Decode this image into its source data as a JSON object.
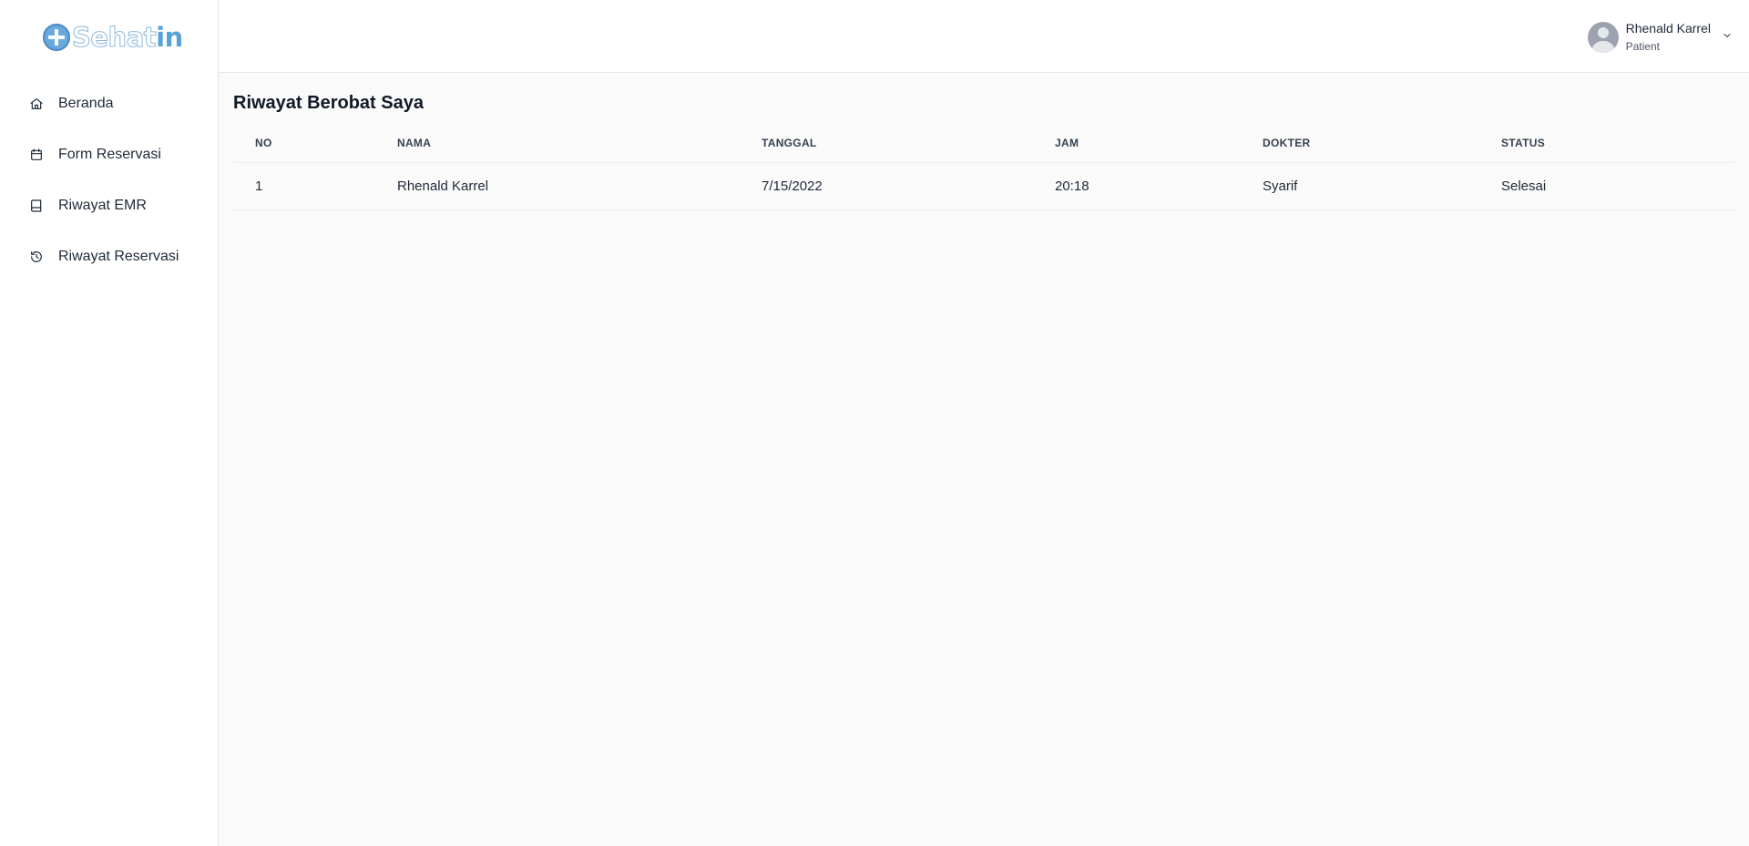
{
  "brand": {
    "part1": "Sehat",
    "part2": "in"
  },
  "sidebar": {
    "items": [
      {
        "label": "Beranda",
        "icon": "home-icon"
      },
      {
        "label": "Form Reservasi",
        "icon": "calendar-icon"
      },
      {
        "label": "Riwayat EMR",
        "icon": "book-icon"
      },
      {
        "label": "Riwayat Reservasi",
        "icon": "history-icon"
      }
    ]
  },
  "header": {
    "user_name": "Rhenald Karrel",
    "user_role": "Patient"
  },
  "main": {
    "title": "Riwayat Berobat Saya",
    "columns": [
      "NO",
      "NAMA",
      "TANGGAL",
      "JAM",
      "DOKTER",
      "STATUS"
    ],
    "rows": [
      [
        "1",
        "Rhenald Karrel",
        "7/15/2022",
        "20:18",
        "Syarif",
        "Selesai"
      ]
    ]
  },
  "colors": {
    "brand_blue": "#5aa1d8",
    "sidebar_bg": "#ffffff",
    "content_bg": "#fafafa",
    "border": "#e5e7eb"
  }
}
